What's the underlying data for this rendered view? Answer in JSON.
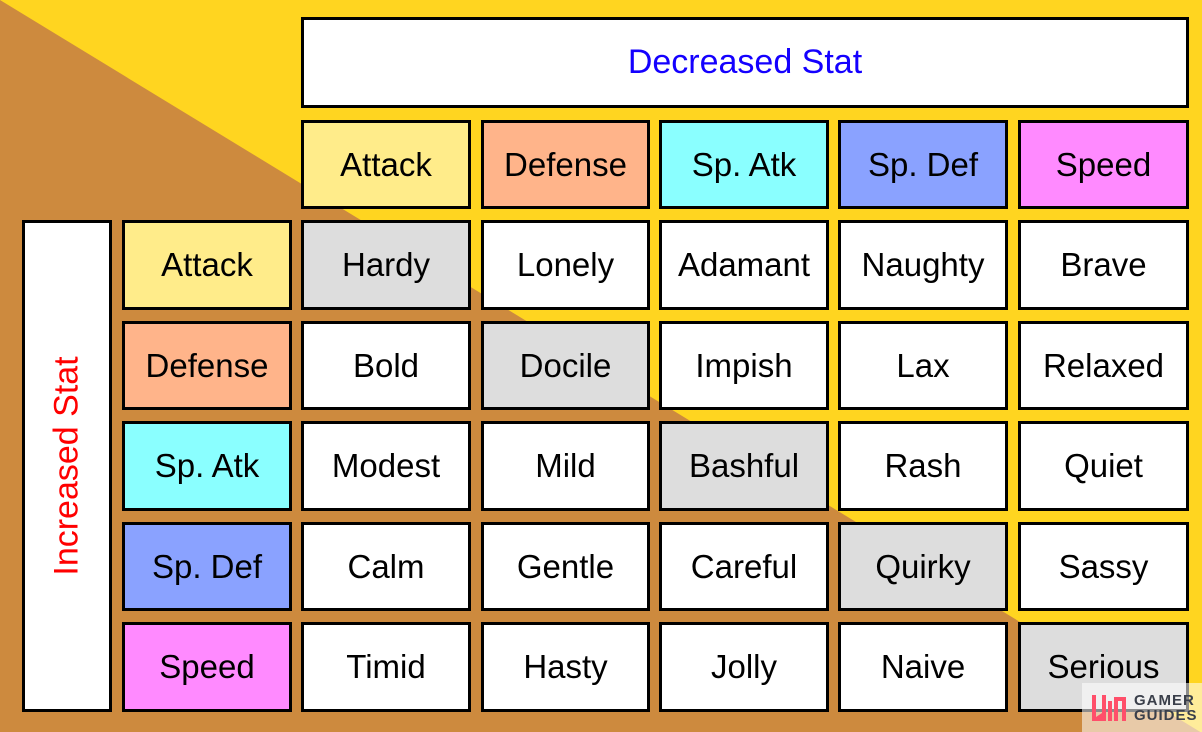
{
  "header": {
    "title": "Decreased Stat",
    "title_color": "#1400FF"
  },
  "side": {
    "title": "Increased Stat",
    "title_color": "#FF0000"
  },
  "stats": [
    {
      "label": "Attack",
      "color": "#FFEC8A"
    },
    {
      "label": "Defense",
      "color": "#FFB48A"
    },
    {
      "label": "Sp. Atk",
      "color": "#8AFFFF"
    },
    {
      "label": "Sp. Def",
      "color": "#8AA2FF"
    },
    {
      "label": "Speed",
      "color": "#FF8AFF"
    }
  ],
  "natures": [
    [
      "Hardy",
      "Lonely",
      "Adamant",
      "Naughty",
      "Brave"
    ],
    [
      "Bold",
      "Docile",
      "Impish",
      "Lax",
      "Relaxed"
    ],
    [
      "Modest",
      "Mild",
      "Bashful",
      "Rash",
      "Quiet"
    ],
    [
      "Calm",
      "Gentle",
      "Careful",
      "Quirky",
      "Sassy"
    ],
    [
      "Timid",
      "Hasty",
      "Jolly",
      "Naive",
      "Serious"
    ]
  ],
  "colors": {
    "background_yellow": "#FFD520",
    "background_brown": "#CD8A3E",
    "neutral_cell": "#DDDDDD",
    "cell": "#FFFFFF"
  },
  "watermark": {
    "line1": "GAMER",
    "line2": "GUIDES"
  }
}
